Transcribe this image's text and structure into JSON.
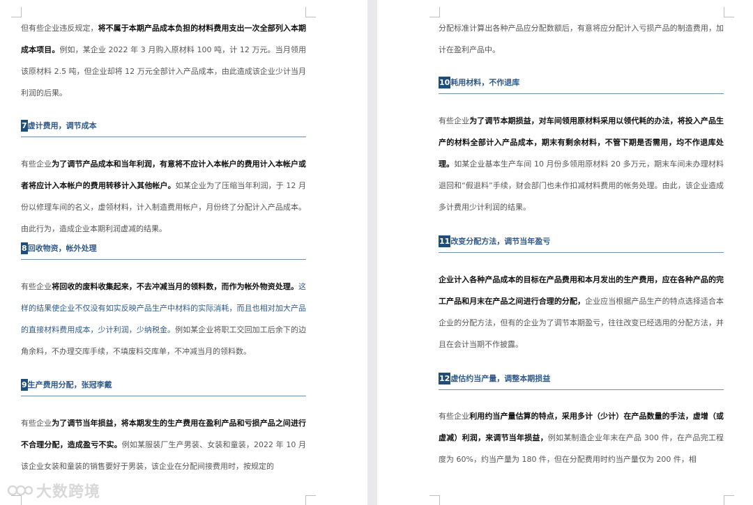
{
  "left_page": {
    "p1": {
      "pre": "但有些企业违反规定，",
      "bold": "将不属于本期产品成本负担的材料费用支出一次全部列入本期成本项目。",
      "rest": "例如，某企业 2022 年 3 月购入原材料 100 吨，计 12 万元。当月领用该原材料 2.5 吨，但企业却将 12 万元全部计入产品成本，由此造成该企业少计当月利润的后果。"
    },
    "h7": {
      "num": "7",
      "title": "虚计费用，调节成本"
    },
    "p7": {
      "pre": "有些企业",
      "bold": "为了调节产品成本和当年利润，有意将不应计入本帐户的费用计入本帐户或者将应计入本帐户的费用转移计入其他帐户。",
      "rest": "如某企业为了压缩当年利润，于 12 月份以修理车间的名义，虚领材料，计入制造费用帐户，月份终了分配计入产品成本。由此行为，造成企业本期利润虚减的结果。"
    },
    "h8": {
      "num": "8",
      "title": "回收物资，帐外处理"
    },
    "p8": {
      "pre": "有些企业",
      "bold": "将回收的废料收集起来，不去冲减当月的领料数，而作为帐外物资处理。",
      "blue": "这样的结果使企业不仅没有如实反映产品生产中材料的实际消耗，而且也相对加大产品的直接材料费用成本，少计利润，少纳税金。",
      "rest": "例如某企业将职工交回加工后余下的边角余料，不办理交库手续，不填废料交库单，不冲减当月的领料数。"
    },
    "h9": {
      "num": "9",
      "title": "生产费用分配，张冠李戴"
    },
    "p9": {
      "pre": "有些企业",
      "bold": "为了调节当年损益，将本期发生的生产费用在盈利产品和亏损产品之间进行不合理分配，造成盈亏不实。",
      "rest": "例如某服装厂生产男装、女装和童装，2022 年 10 月该企业女装和童装的销售要好于男装，该企业在分配间接费用时，按规定的"
    }
  },
  "right_page": {
    "p0": {
      "rest": "分配标准计算出各种产品应分配数额后，有意将应分配计入亏损产品的制造费用，加计在盈利产品中。"
    },
    "h10": {
      "num": "10",
      "title": "耗用材料，不作退库"
    },
    "p10": {
      "pre": "有些企业",
      "bold": "为了调节本期损益，对车间领用原材料采用以领代耗的办法，将投入产品生产的材料全部计入产品成本，期末有剩余材料，不管下期是否需用，均不作退库处理。",
      "rest": "如某企业基本生产车间 10 月份多领用原材料 20 多万元，期末车间未办理材料退回和“假退料”手续，财会部门也未作扣减材料费用的帐务处理。由此，该企业造成多计费用少计利润的结果。"
    },
    "h11": {
      "num": "11",
      "title": "改变分配方法，调节当年盈亏"
    },
    "p11": {
      "bold": "企业计入各种产品成本的目标在产品费用和本月发出的生产费用，应在各种产品的完工产品和月末在产品之间进行合理的分配，",
      "rest": "企业应当根据产品生产的特点选择适合本企业的分配方法，但有的企业为了调节本期盈亏，往往改变已经选用的分配方法，并且在会计当期不作披露。"
    },
    "h12": {
      "num": "12",
      "title": "虚估约当产量，调整本期损益"
    },
    "p12": {
      "pre": "有些企业",
      "bold": "利用约当产量估算的特点，采用多计（少计）在产品数量的手法，虚增（或虚减）利润，来调节当年损益，",
      "rest": "例如某制造企业年末在产品 300 件，在产品完工程度为 60%，约当产量为 180 件，但在分配费用时约当产量仅为 200 件，相"
    }
  },
  "watermark": {
    "text": "大数跨境"
  },
  "colors": {
    "accent": "#1f4e79",
    "heading": "#2f5a8a",
    "body": "#555555",
    "bold": "#111111",
    "gutter": "#e9e9eb"
  }
}
